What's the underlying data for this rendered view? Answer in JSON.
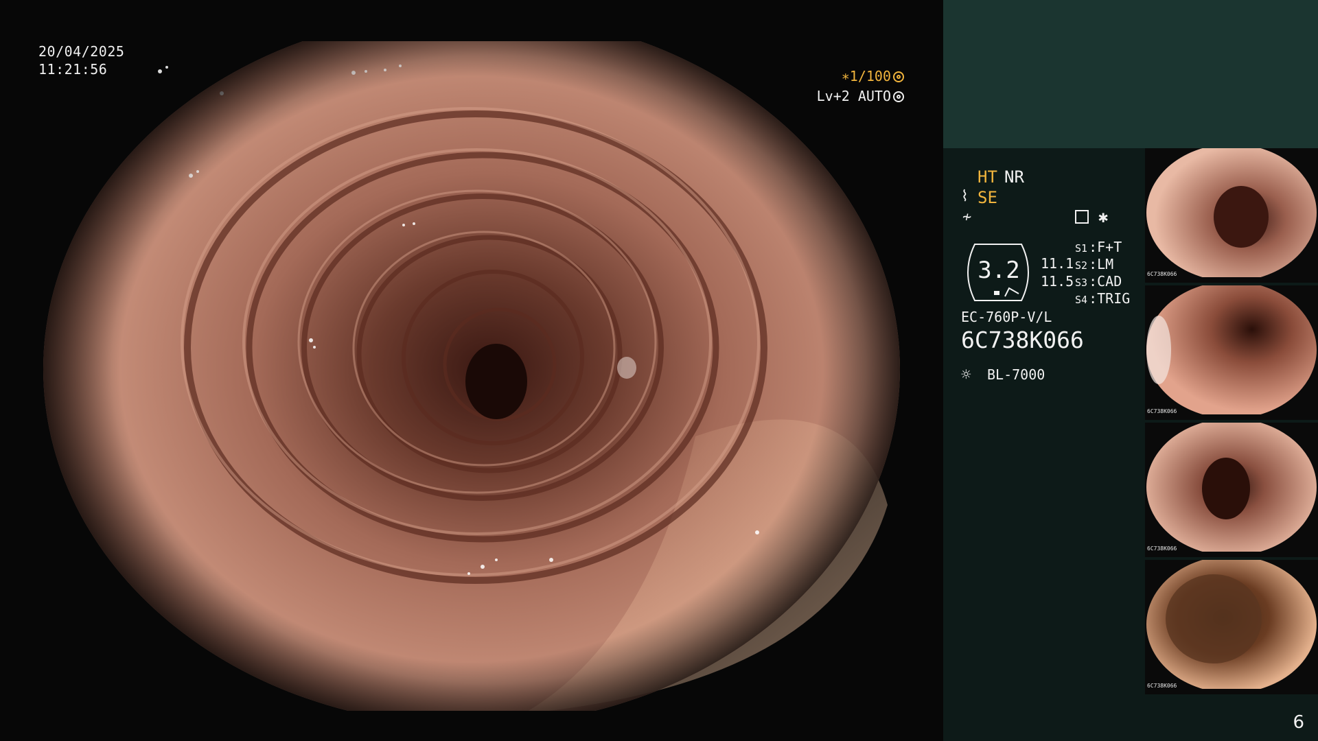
{
  "overlay": {
    "date": "20/04/2025",
    "time": "11:21:56",
    "shutter": "∗1/100",
    "level": "Lv+2 AUTO"
  },
  "settings": {
    "mode_ht": "HT",
    "mode_nr": "NR",
    "mode_se": "SE",
    "zoom_left": "11.1",
    "zoom_right": "11.5",
    "gauge_value": "3.2",
    "star": "✱",
    "switches": [
      {
        "key": "S1",
        "value": "F+T"
      },
      {
        "key": "S2",
        "value": "LM"
      },
      {
        "key": "S3",
        "value": "CAD"
      },
      {
        "key": "S4",
        "value": "TRIG"
      }
    ],
    "scope_model": "EC-760P-V/L",
    "scope_serial": "6C738K066",
    "light_source": "BL-7000"
  },
  "thumbnails": [
    {
      "caption": "6C738K066"
    },
    {
      "caption": "6C738K066"
    },
    {
      "caption": "6C738K066"
    },
    {
      "caption": "6C738K066"
    }
  ],
  "page_number": "6",
  "colors": {
    "amber": "#f2b53d",
    "panel_dark": "#0d1a18",
    "panel_top": "#1b3530",
    "mucosa": "#c58d78"
  }
}
